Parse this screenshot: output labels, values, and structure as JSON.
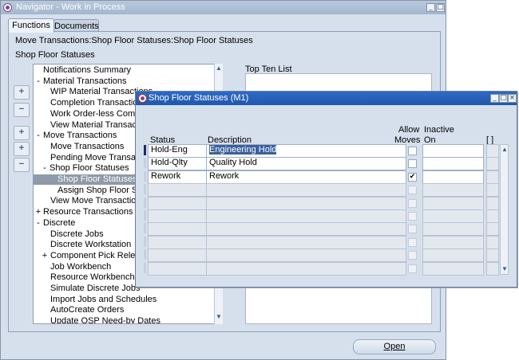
{
  "navigator": {
    "title": "Navigator - Work in Process",
    "tabs": [
      "Functions",
      "Documents"
    ],
    "breadcrumb": "Move Transactions:Shop Floor Statuses:Shop Floor Statuses",
    "section_label": "Shop Floor Statuses",
    "top_ten_label": "Top Ten List",
    "open_button": "Open",
    "window_buttons": [
      "_",
      "□",
      "×"
    ],
    "tree": [
      {
        "sign": "",
        "label": "Notifications Summary"
      },
      {
        "sign": "-",
        "label": "Material Transactions"
      },
      {
        "sign": "",
        "label": "WIP Material Transactions"
      },
      {
        "sign": "",
        "label": "Completion Transactions"
      },
      {
        "sign": "",
        "label": "Work Order-less Completion"
      },
      {
        "sign": "",
        "label": "View Material Transactions"
      },
      {
        "sign": "-",
        "label": "Move Transactions"
      },
      {
        "sign": "",
        "label": "Move Transactions"
      },
      {
        "sign": "",
        "label": "Pending Move Transactions"
      },
      {
        "sign": "-",
        "label": "Shop Floor Statuses"
      },
      {
        "sign": "",
        "label": "Shop Floor Statuses"
      },
      {
        "sign": "",
        "label": "Assign Shop Floor Statuses"
      },
      {
        "sign": "",
        "label": "View Move Transactions"
      },
      {
        "sign": "+",
        "label": "Resource Transactions"
      },
      {
        "sign": "-",
        "label": "Discrete"
      },
      {
        "sign": "",
        "label": "Discrete Jobs"
      },
      {
        "sign": "",
        "label": "Discrete Workstation"
      },
      {
        "sign": "+",
        "label": "Component Pick Release"
      },
      {
        "sign": "",
        "label": "Job Workbench"
      },
      {
        "sign": "",
        "label": "Resource Workbench"
      },
      {
        "sign": "",
        "label": "Simulate Discrete Jobs"
      },
      {
        "sign": "",
        "label": "Import Jobs and Schedules"
      },
      {
        "sign": "",
        "label": "AutoCreate Orders"
      },
      {
        "sign": "",
        "label": "Update OSP Need-by Dates"
      }
    ],
    "side_buttons": [
      "+",
      "−",
      "+",
      "+",
      "−"
    ]
  },
  "sfs": {
    "title": "Shop Floor Statuses (M1)",
    "headers": {
      "status": "Status",
      "description": "Description",
      "allow_moves": [
        "Allow",
        "Moves"
      ],
      "inactive_on": [
        "Inactive",
        "On"
      ],
      "flex": "[ ]"
    },
    "rows": [
      {
        "status": "Hold-Eng",
        "description": "Engineering Hold",
        "allow_moves": "",
        "inactive_on": ""
      },
      {
        "status": "Hold-Qlty",
        "description": "Quality Hold",
        "allow_moves": "",
        "inactive_on": ""
      },
      {
        "status": "Rework",
        "description": "Rework",
        "allow_moves": "✔",
        "inactive_on": ""
      },
      {
        "status": "",
        "description": "",
        "allow_moves": "",
        "inactive_on": ""
      },
      {
        "status": "",
        "description": "",
        "allow_moves": "",
        "inactive_on": ""
      },
      {
        "status": "",
        "description": "",
        "allow_moves": "",
        "inactive_on": ""
      },
      {
        "status": "",
        "description": "",
        "allow_moves": "",
        "inactive_on": ""
      },
      {
        "status": "",
        "description": "",
        "allow_moves": "",
        "inactive_on": ""
      },
      {
        "status": "",
        "description": "",
        "allow_moves": "",
        "inactive_on": ""
      },
      {
        "status": "",
        "description": "",
        "allow_moves": "",
        "inactive_on": ""
      }
    ]
  }
}
